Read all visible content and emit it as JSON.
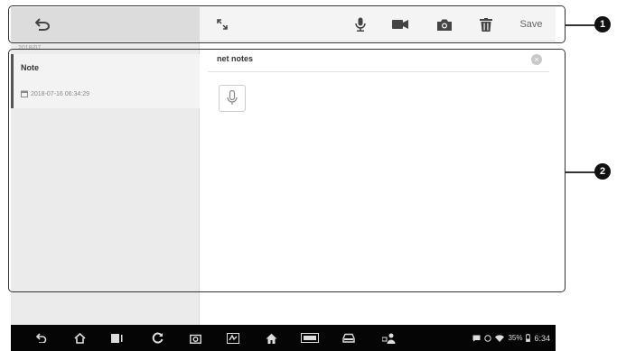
{
  "toolbar": {
    "save_label": "Save"
  },
  "notes_list": {
    "month": "2018/07",
    "items": [
      {
        "title": "Note",
        "timestamp": "2018-07-16 06:34:29"
      }
    ]
  },
  "note_detail": {
    "title_value": "net notes"
  },
  "callouts": [
    "1",
    "2"
  ],
  "status_bar": {
    "battery": "35%",
    "time": "6:34"
  },
  "colors": {
    "toolbar_bg": "#f4f4f4",
    "left_pane_bg": "#ebebeb",
    "selected_indicator": "#555555",
    "navbar_bg": "#050505"
  }
}
